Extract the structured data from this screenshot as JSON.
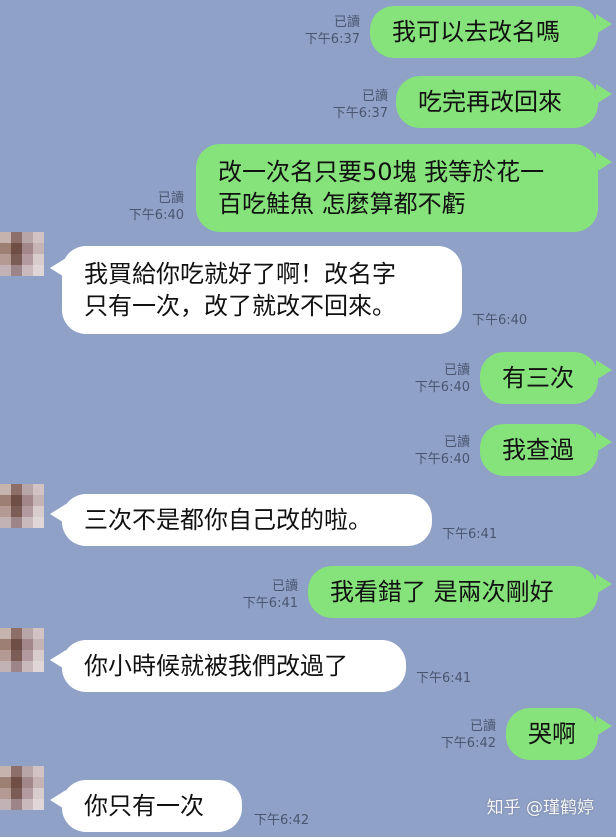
{
  "chat": {
    "messages": [
      {
        "direction": "out",
        "text": "我可以去改名嗎",
        "read": "已讀",
        "time": "下午6:37"
      },
      {
        "direction": "out",
        "text": "吃完再改回來",
        "read": "已讀",
        "time": "下午6:37"
      },
      {
        "direction": "out",
        "lines": [
          "改一次名只要50塊 我等於花一",
          "百吃鮭魚 怎麼算都不虧"
        ],
        "read": "已讀",
        "time": "下午6:40"
      },
      {
        "direction": "in",
        "lines": [
          "我買給你吃就好了啊！改名字",
          "只有一次，改了就改不回來。"
        ],
        "time": "下午6:40"
      },
      {
        "direction": "out",
        "text": "有三次",
        "read": "已讀",
        "time": "下午6:40"
      },
      {
        "direction": "out",
        "text": "我查過",
        "read": "已讀",
        "time": "下午6:40"
      },
      {
        "direction": "in",
        "text": "三次不是都你自己改的啦。",
        "time": "下午6:41"
      },
      {
        "direction": "out",
        "text": "我看錯了 是兩次剛好",
        "read": "已讀",
        "time": "下午6:41"
      },
      {
        "direction": "in",
        "text": "你小時候就被我們改過了",
        "time": "下午6:41"
      },
      {
        "direction": "out",
        "text": "哭啊",
        "read": "已讀",
        "time": "下午6:42"
      },
      {
        "direction": "in",
        "text": "你只有一次",
        "time": "下午6:42"
      }
    ]
  },
  "watermark": {
    "text": "知乎 @瑾鹤婷"
  },
  "colors": {
    "background": "#8fa1c7",
    "outgoing_bubble": "#86e27a",
    "incoming_bubble": "#ffffff"
  }
}
